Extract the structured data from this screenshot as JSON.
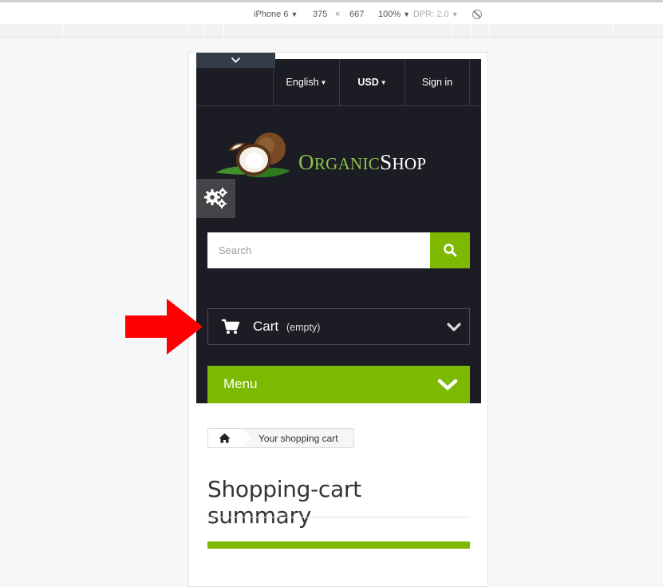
{
  "devtools": {
    "device": "iPhone 6",
    "width": "375",
    "times": "×",
    "height": "667",
    "zoom": "100%",
    "dpr": "DPR: 2.0"
  },
  "nav": {
    "language": "English",
    "currency": "USD",
    "signin": "Sign in"
  },
  "logo": {
    "part1_cap": "O",
    "part1_rest": "RGANIC",
    "part2_cap": "S",
    "part2_rest": "HOP"
  },
  "search": {
    "placeholder": "Search"
  },
  "cart": {
    "label": "Cart",
    "status": "(empty)"
  },
  "menu": {
    "label": "Menu"
  },
  "breadcrumb": {
    "current": "Your shopping cart"
  },
  "page": {
    "title": "Shopping-cart summary"
  },
  "colors": {
    "accent": "#7cb900",
    "header_bg": "#1c1c24",
    "arrow": "#ff0000"
  }
}
